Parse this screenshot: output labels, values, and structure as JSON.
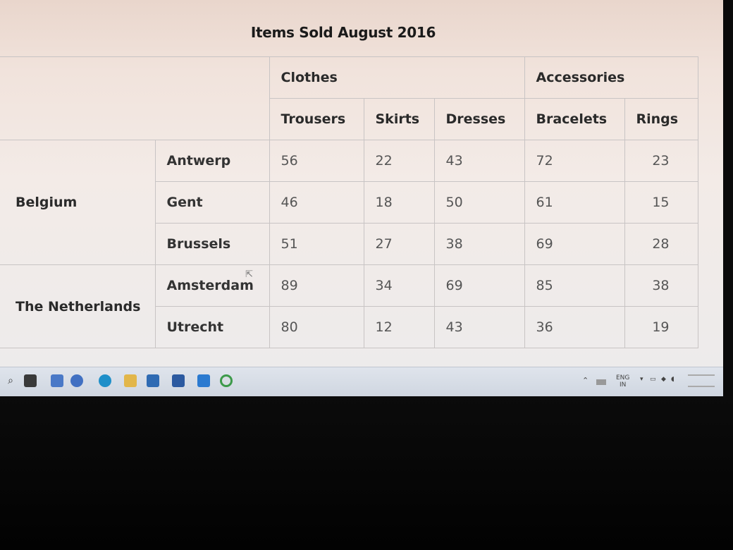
{
  "title": "Items Sold August 2016",
  "headers": {
    "groups": [
      "Clothes",
      "Accessories"
    ],
    "items": [
      "Trousers",
      "Skirts",
      "Dresses",
      "Bracelets",
      "Rings"
    ]
  },
  "countries": [
    {
      "name": "Belgium",
      "cities": [
        {
          "name": "Antwerp",
          "values": [
            "56",
            "22",
            "43",
            "72",
            "23"
          ]
        },
        {
          "name": "Gent",
          "values": [
            "46",
            "18",
            "50",
            "61",
            "15"
          ]
        },
        {
          "name": "Brussels",
          "values": [
            "51",
            "27",
            "38",
            "69",
            "28"
          ]
        }
      ]
    },
    {
      "name": "The Netherlands",
      "cities": [
        {
          "name": "Amsterdam",
          "values": [
            "89",
            "34",
            "69",
            "85",
            "38"
          ]
        },
        {
          "name": "Utrecht",
          "values": [
            "80",
            "12",
            "43",
            "36",
            "19"
          ]
        }
      ]
    }
  ],
  "taskbar": {
    "icons": [
      "search-icon",
      "task-view-icon",
      "file-explorer-icon",
      "cortana-icon",
      "edge-icon",
      "folder-icon",
      "store-icon",
      "mail-icon",
      "vscode-icon",
      "chrome-icon"
    ],
    "tray": {
      "language": "ENG",
      "region": "IN"
    }
  }
}
